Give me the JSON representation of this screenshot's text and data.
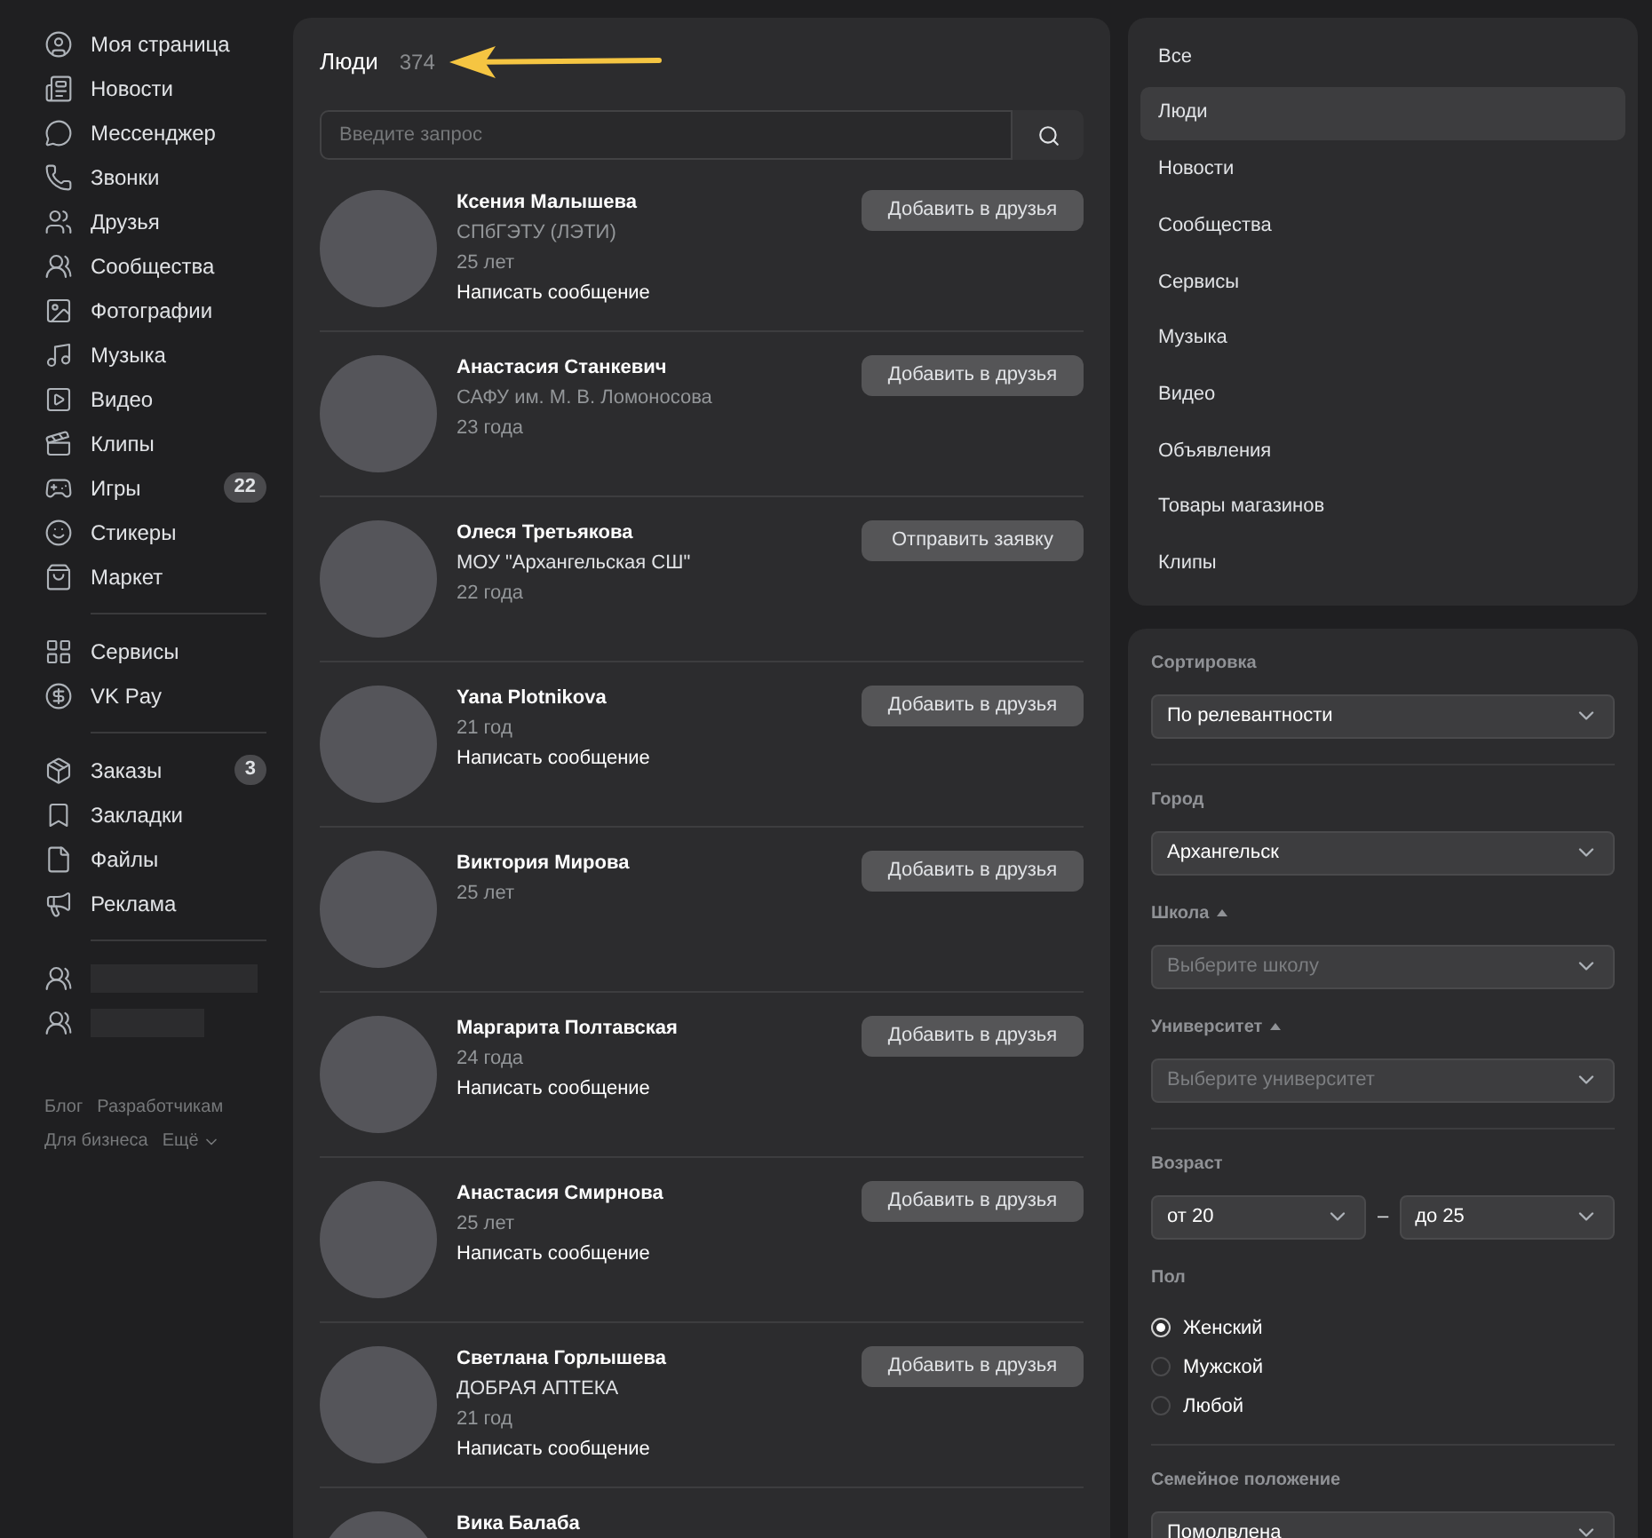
{
  "sidebar": {
    "groups": [
      [
        {
          "label": "Моя страница"
        },
        {
          "label": "Новости"
        },
        {
          "label": "Мессенджер"
        },
        {
          "label": "Звонки"
        },
        {
          "label": "Друзья"
        },
        {
          "label": "Сообщества"
        },
        {
          "label": "Фотографии"
        },
        {
          "label": "Музыка"
        },
        {
          "label": "Видео"
        },
        {
          "label": "Клипы"
        },
        {
          "label": "Игры",
          "badge": "22"
        },
        {
          "label": "Стикеры"
        },
        {
          "label": "Маркет"
        }
      ],
      [
        {
          "label": "Сервисы"
        },
        {
          "label": "VK Pay"
        }
      ],
      [
        {
          "label": "Заказы",
          "badge": "3"
        },
        {
          "label": "Закладки"
        },
        {
          "label": "Файлы"
        },
        {
          "label": "Реклама"
        }
      ]
    ],
    "footer_links": [
      {
        "label": "Блог"
      },
      {
        "label": "Разработчикам"
      },
      {
        "label": "Для бизнеса"
      },
      {
        "label": "Ещё",
        "dropdown": true
      }
    ]
  },
  "results": {
    "title": "Люди",
    "count": "374",
    "search": {
      "placeholder": "Введите запрос"
    },
    "people": [
      {
        "name": "Ксения Малышева",
        "lines": [
          {
            "kind": "muted",
            "text": "СПбГЭТУ (ЛЭТИ)"
          },
          {
            "kind": "muted",
            "text": "25 лет"
          },
          {
            "kind": "link",
            "text": "Написать сообщение"
          }
        ],
        "action": "Добавить в друзья"
      },
      {
        "name": "Анастасия Станкевич",
        "lines": [
          {
            "kind": "muted",
            "text": "САФУ им. М. В. Ломоносова"
          },
          {
            "kind": "muted",
            "text": "23 года"
          }
        ],
        "action": "Добавить в друзья"
      },
      {
        "name": "Олеся Третьякова",
        "lines": [
          {
            "kind": "plain",
            "text": "МОУ \"Архангельская СШ\""
          },
          {
            "kind": "muted",
            "text": "22 года"
          }
        ],
        "action": "Отправить заявку"
      },
      {
        "name": "Yana Plotnikova",
        "lines": [
          {
            "kind": "muted",
            "text": "21 год"
          },
          {
            "kind": "link",
            "text": "Написать сообщение"
          }
        ],
        "action": "Добавить в друзья"
      },
      {
        "name": "Виктория Мирова",
        "lines": [
          {
            "kind": "muted",
            "text": "25 лет"
          }
        ],
        "action": "Добавить в друзья"
      },
      {
        "name": "Маргарита Полтавская",
        "lines": [
          {
            "kind": "muted",
            "text": "24 года"
          },
          {
            "kind": "link",
            "text": "Написать сообщение"
          }
        ],
        "action": "Добавить в друзья"
      },
      {
        "name": "Анастасия Смирнова",
        "lines": [
          {
            "kind": "muted",
            "text": "25 лет"
          },
          {
            "kind": "link",
            "text": "Написать сообщение"
          }
        ],
        "action": "Добавить в друзья"
      },
      {
        "name": "Светлана Горлышева",
        "lines": [
          {
            "kind": "plain",
            "text": "ДОБРАЯ АПТЕКА"
          },
          {
            "kind": "muted",
            "text": "21 год"
          },
          {
            "kind": "link",
            "text": "Написать сообщение"
          }
        ],
        "action": "Добавить в друзья"
      },
      {
        "name": "Вика Балаба"
      }
    ]
  },
  "categories": [
    {
      "label": "Все",
      "selected": false
    },
    {
      "label": "Люди",
      "selected": true
    },
    {
      "label": "Новости",
      "selected": false
    },
    {
      "label": "Сообщества",
      "selected": false
    },
    {
      "label": "Сервисы",
      "selected": false
    },
    {
      "label": "Музыка",
      "selected": false
    },
    {
      "label": "Видео",
      "selected": false
    },
    {
      "label": "Объявления",
      "selected": false
    },
    {
      "label": "Товары магазинов",
      "selected": false
    },
    {
      "label": "Клипы",
      "selected": false
    }
  ],
  "filter_sections": [
    [
      {
        "kind": "select",
        "label": "Сортировка",
        "value": "По релевантности"
      }
    ],
    [
      {
        "kind": "select",
        "label": "Город",
        "value": "Архангельск"
      },
      {
        "kind": "select",
        "label": "Школа",
        "caret": true,
        "placeholder": "Выберите школу"
      },
      {
        "kind": "select",
        "label": "Университет",
        "caret": true,
        "placeholder": "Выберите университет"
      }
    ],
    [
      {
        "kind": "range",
        "label": "Возраст",
        "from": "от 20",
        "separator": "–",
        "to": "до 25"
      },
      {
        "kind": "radio",
        "label": "Пол",
        "options": [
          {
            "label": "Женский",
            "selected": true
          },
          {
            "label": "Мужской",
            "selected": false
          },
          {
            "label": "Любой",
            "selected": false
          }
        ]
      }
    ],
    [
      {
        "kind": "select",
        "label": "Семейное положение",
        "value": "Помолвлена"
      }
    ]
  ]
}
